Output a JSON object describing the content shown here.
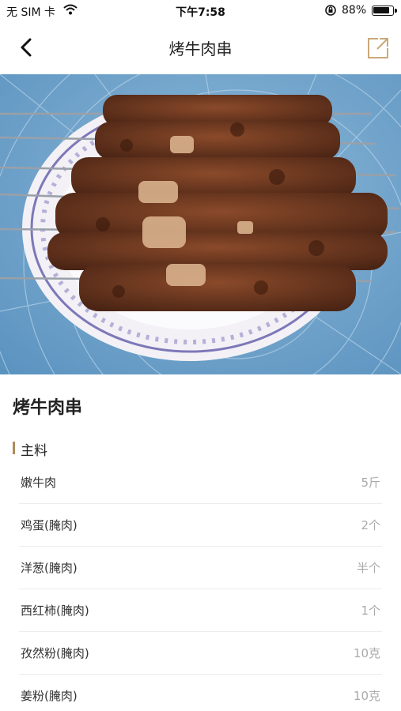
{
  "status_bar": {
    "carrier": "无 SIM 卡",
    "time": "下午7:58",
    "battery_percent_text": "88%",
    "battery_level": 0.88
  },
  "nav": {
    "title": "烤牛肉串"
  },
  "recipe": {
    "title": "烤牛肉串",
    "section_title": "主料",
    "ingredients": [
      {
        "name": "嫩牛肉",
        "qty": "5斤"
      },
      {
        "name": "鸡蛋(腌肉)",
        "qty": "2个"
      },
      {
        "name": "洋葱(腌肉)",
        "qty": "半个"
      },
      {
        "name": "西红柿(腌肉)",
        "qty": "1个"
      },
      {
        "name": "孜然粉(腌肉)",
        "qty": "10克"
      },
      {
        "name": "姜粉(腌肉)",
        "qty": "10克"
      }
    ]
  },
  "colors": {
    "accent": "#b08a5a",
    "share_icon": "#c9a97a",
    "background_tablecloth": "#6fa4cc"
  }
}
